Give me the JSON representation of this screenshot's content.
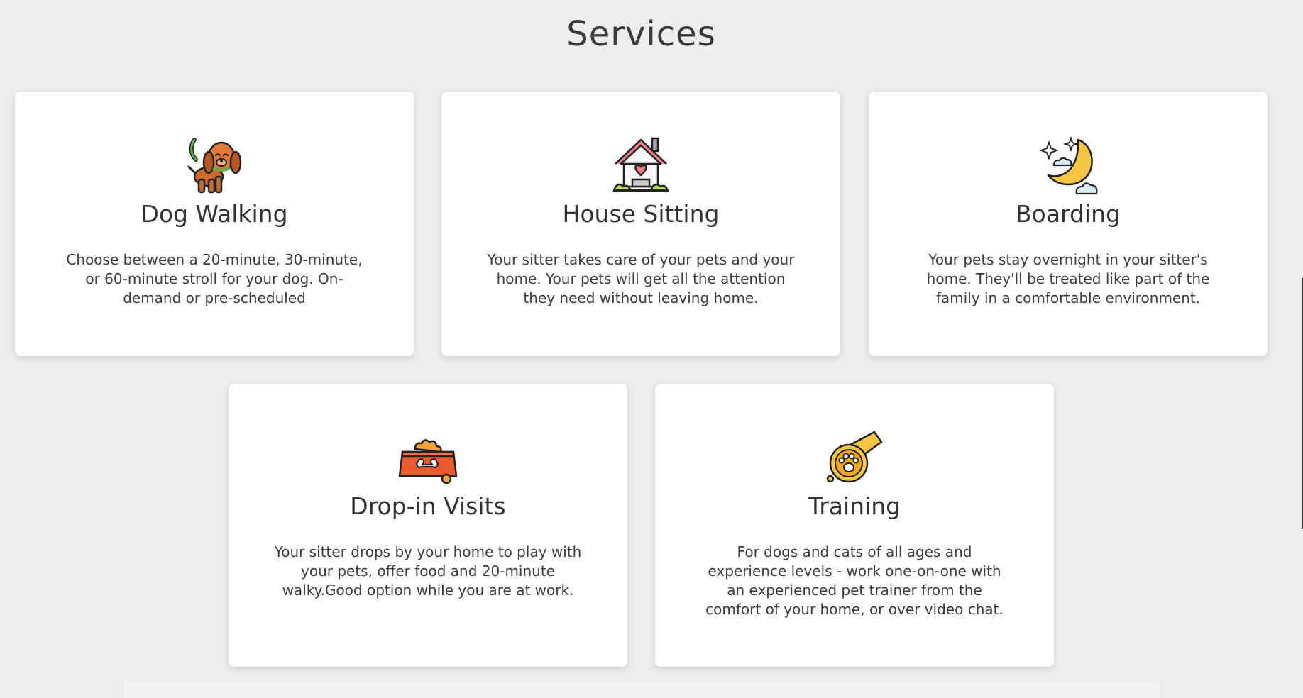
{
  "page": {
    "title": "Services"
  },
  "services": [
    {
      "title": "Dog Walking",
      "description": "Choose between a 20-minute, 30-minute, or 60-minute stroll for your dog. On-demand or pre-scheduled",
      "icon": "dog-on-leash-icon"
    },
    {
      "title": "House Sitting",
      "description": "Your sitter takes care of your pets and your home. Your pets will get all the attention they need without leaving home.",
      "icon": "house-with-heart-icon"
    },
    {
      "title": "Boarding",
      "description": "Your pets stay overnight in your sitter's home. They'll be treated like part of the family in a comfortable environment.",
      "icon": "moon-stars-clouds-icon"
    },
    {
      "title": "Drop-in Visits",
      "description": "Your sitter drops by your home to play with your pets, offer food and 20-minute walky.Good option while you are at work.",
      "icon": "pet-food-bowl-icon"
    },
    {
      "title": "Training",
      "description": "For dogs and cats of all ages and experience levels - work one-on-one with an experienced pet trainer from the comfort of your home, or over video chat.",
      "icon": "paw-whistle-icon"
    }
  ],
  "colors": {
    "background": "#ededed",
    "card": "#ffffff",
    "text": "#333333",
    "accent_orange": "#e0793a",
    "accent_yellow": "#f6c543"
  }
}
